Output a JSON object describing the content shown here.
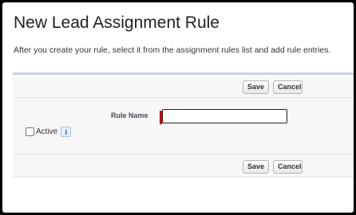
{
  "page": {
    "title": "New Lead Assignment Rule",
    "description": "After you create your rule, select it from the assignment rules list and add rule entries."
  },
  "toolbar_top": {
    "save_label": "Save",
    "cancel_label": "Cancel"
  },
  "form": {
    "rule_name_label": "Rule Name",
    "rule_name_value": "",
    "active_label": "Active",
    "active_checked": false,
    "info_icon_glyph": "i"
  },
  "toolbar_bottom": {
    "save_label": "Save",
    "cancel_label": "Cancel"
  },
  "colors": {
    "required": "#cc0000",
    "panel_accent": "#c9d3df",
    "info": "#2a6ebb"
  },
  "icons": [
    "info-icon"
  ]
}
